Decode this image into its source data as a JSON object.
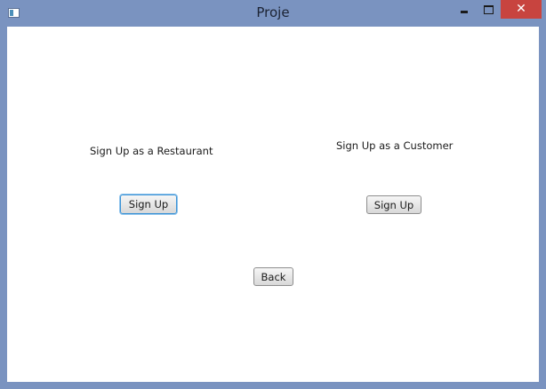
{
  "window": {
    "title": "Proje",
    "close_symbol": "✕"
  },
  "restaurant": {
    "label": "Sign Up as a Restaurant",
    "button_label": "Sign Up"
  },
  "customer": {
    "label": "Sign Up as a Customer",
    "button_label": "Sign Up"
  },
  "back": {
    "button_label": "Back"
  },
  "colors": {
    "frame": "#7a93c0",
    "close_button": "#c8443f",
    "focus_ring": "#3c93d6"
  },
  "icons": {
    "app": "app-window-icon",
    "minimize": "minimize-icon",
    "maximize": "maximize-icon",
    "close": "close-icon"
  }
}
